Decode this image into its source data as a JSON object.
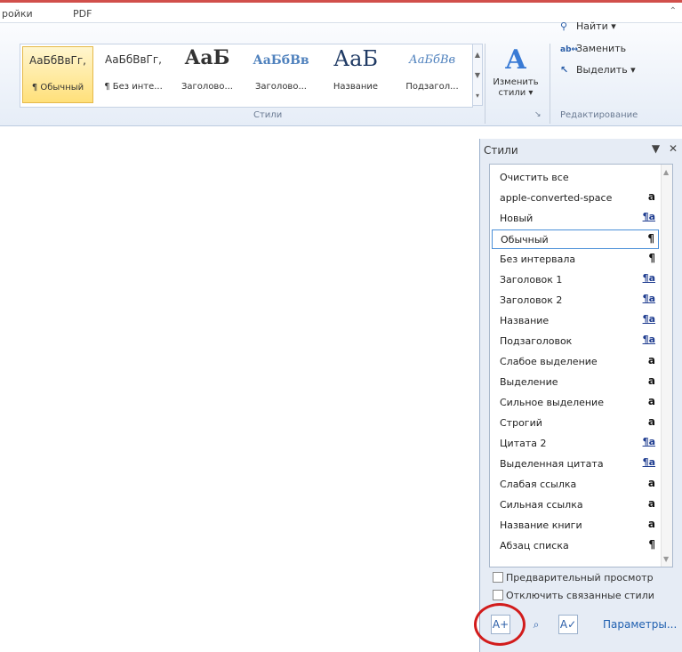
{
  "tabs": {
    "settings_tab": "ройки",
    "pdf_tab": "PDF"
  },
  "ribbon": {
    "styles_group_label": "Стили",
    "editing_group_label": "Редактирование",
    "gallery": [
      {
        "preview": "АаБбВвГг,",
        "label": "¶ Обычный"
      },
      {
        "preview": "АаБбВвГг,",
        "label": "¶ Без инте..."
      },
      {
        "preview": "АаБ",
        "label": "Заголово..."
      },
      {
        "preview": "АаБбВв",
        "label": "Заголово..."
      },
      {
        "preview": "АаБ",
        "label": "Название"
      },
      {
        "preview": "АаБбВв",
        "label": "Подзагол..."
      }
    ],
    "change_styles": {
      "line1": "Изменить",
      "line2": "стили ▾"
    },
    "editing": {
      "find": "Найти ▾",
      "replace": "Заменить",
      "select": "Выделить ▾"
    }
  },
  "pane": {
    "title": "Стили",
    "styles": [
      {
        "name": "Очистить все",
        "mark": ""
      },
      {
        "name": "apple-converted-space",
        "mark": "a"
      },
      {
        "name": "Новый",
        "mark": "¶a"
      },
      {
        "name": "Обычный",
        "mark": "¶"
      },
      {
        "name": "Без интервала",
        "mark": "¶"
      },
      {
        "name": "Заголовок 1",
        "mark": "¶a"
      },
      {
        "name": "Заголовок 2",
        "mark": "¶a"
      },
      {
        "name": "Название",
        "mark": "¶a"
      },
      {
        "name": "Подзаголовок",
        "mark": "¶a"
      },
      {
        "name": "Слабое выделение",
        "mark": "a"
      },
      {
        "name": "Выделение",
        "mark": "a"
      },
      {
        "name": "Сильное выделение",
        "mark": "a"
      },
      {
        "name": "Строгий",
        "mark": "a"
      },
      {
        "name": "Цитата 2",
        "mark": "¶a"
      },
      {
        "name": "Выделенная цитата",
        "mark": "¶a"
      },
      {
        "name": "Слабая ссылка",
        "mark": "a"
      },
      {
        "name": "Сильная ссылка",
        "mark": "a"
      },
      {
        "name": "Название книги",
        "mark": "a"
      },
      {
        "name": "Абзац списка",
        "mark": "¶"
      }
    ],
    "preview_checkbox": "Предварительный просмотр",
    "disable_linked_checkbox": "Отключить связанные стили",
    "options_link": "Параметры..."
  },
  "colors": {
    "highlight_circle": "#d21c1c",
    "accent": "#2060b0"
  }
}
